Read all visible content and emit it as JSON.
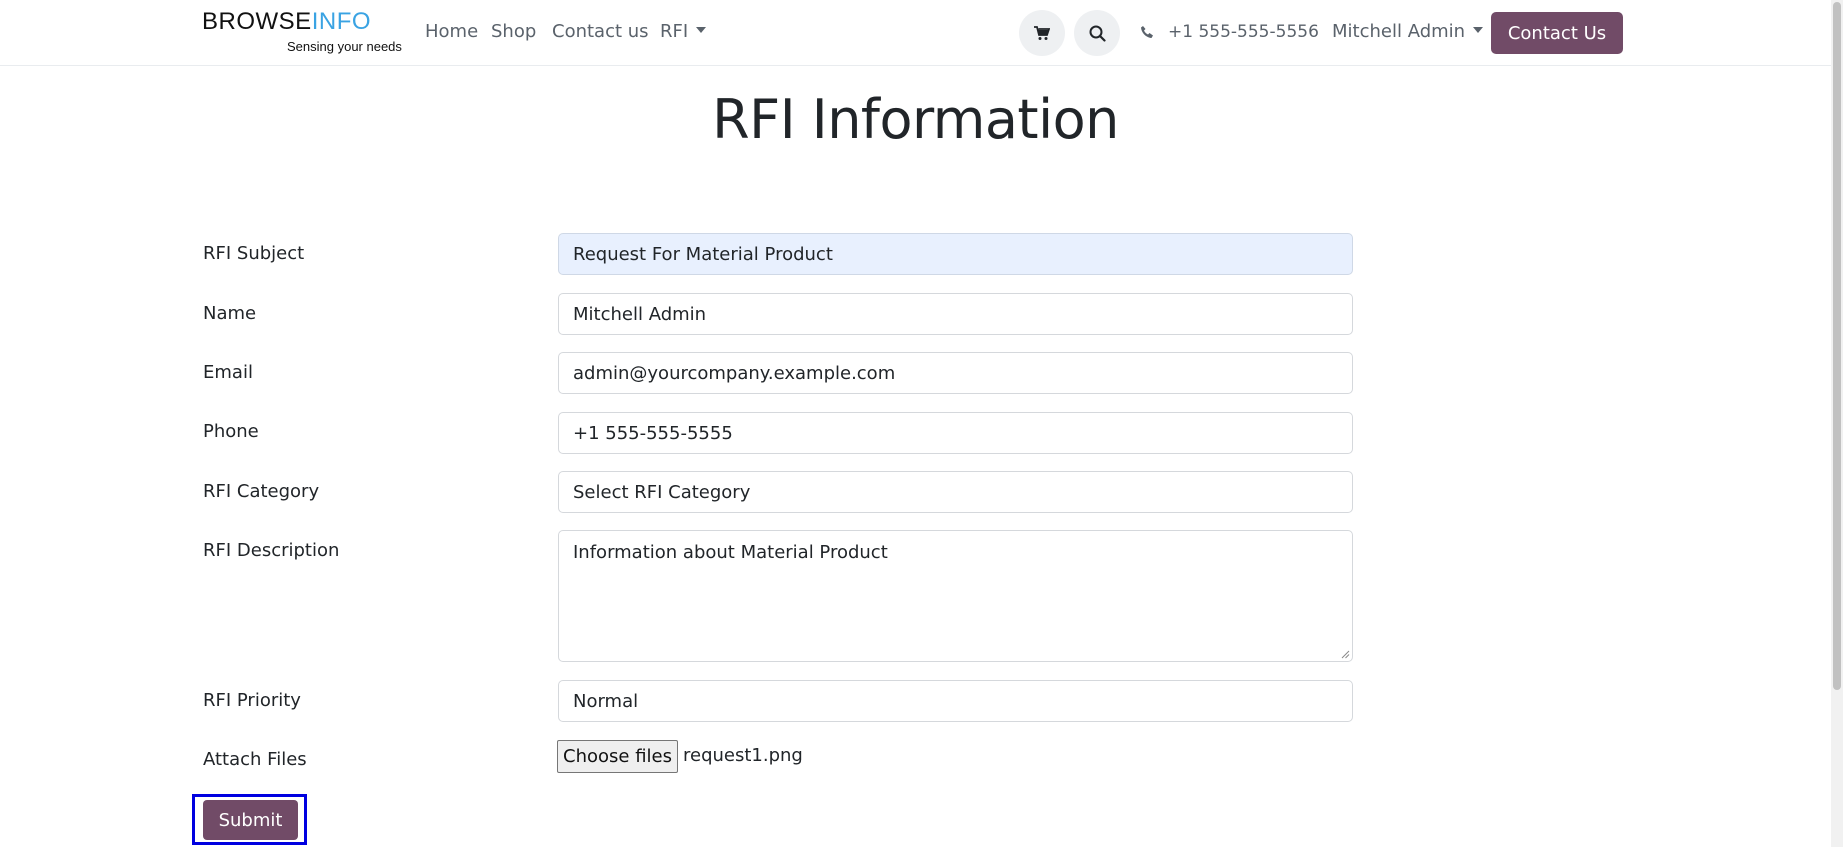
{
  "header": {
    "logo": {
      "word_browse": "BROWSE",
      "word_info": "INFO",
      "tagline": "Sensing your needs"
    },
    "nav": [
      {
        "label": "Home"
      },
      {
        "label": "Shop"
      },
      {
        "label": "Contact us"
      },
      {
        "label": "RFI"
      }
    ],
    "phone": "+1 555-555-5556",
    "user": "Mitchell Admin",
    "contact_button": "Contact Us",
    "icons": {
      "cart": "cart-icon",
      "search": "search-icon",
      "phone": "phone-icon"
    },
    "accent_color": "#714b67"
  },
  "page": {
    "title": "RFI Information"
  },
  "form": {
    "subject": {
      "label": "RFI Subject",
      "value": "Request For Material Product"
    },
    "name": {
      "label": "Name",
      "value": "Mitchell Admin"
    },
    "email": {
      "label": "Email",
      "value": "admin@yourcompany.example.com"
    },
    "phone": {
      "label": "Phone",
      "value": "+1 555-555-5555"
    },
    "category": {
      "label": "RFI Category",
      "value": "Select RFI Category"
    },
    "description": {
      "label": "RFI Description",
      "value": "Information about Material Product"
    },
    "priority": {
      "label": "RFI Priority",
      "value": "Normal"
    },
    "attach": {
      "label": "Attach Files",
      "button": "Choose files",
      "file_name": "request1.png"
    },
    "submit": "Submit"
  }
}
